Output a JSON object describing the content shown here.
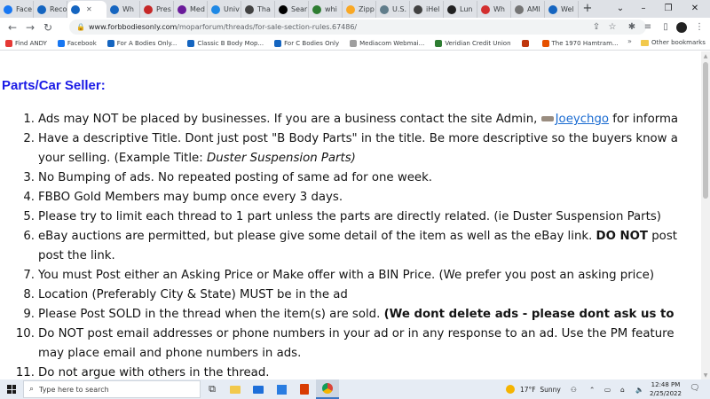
{
  "tabs": [
    {
      "label": "Face",
      "color": "#1877f2"
    },
    {
      "label": "Reco",
      "color": "#1565c0"
    },
    {
      "label": "",
      "color": "#1565c0",
      "active": true
    },
    {
      "label": "Wh",
      "color": "#1565c0"
    },
    {
      "label": "Pres",
      "color": "#c62828"
    },
    {
      "label": "Med",
      "color": "#6a1b9a"
    },
    {
      "label": "Univ",
      "color": "#1e88e5"
    },
    {
      "label": "Tha",
      "color": "#424242"
    },
    {
      "label": "Sear",
      "color": "#000000"
    },
    {
      "label": "whi",
      "color": "#2e7d32"
    },
    {
      "label": "Zipp",
      "color": "#f9a825"
    },
    {
      "label": "U.S.",
      "color": "#607d8b"
    },
    {
      "label": "iHel",
      "color": "#424242"
    },
    {
      "label": "Lun",
      "color": "#212121"
    },
    {
      "label": "Wh",
      "color": "#d32f2f"
    },
    {
      "label": "AMI",
      "color": "#757575"
    },
    {
      "label": "Wel",
      "color": "#1565c0"
    }
  ],
  "window_controls": {
    "minimize": "–",
    "maximize": "❐",
    "close": "✕",
    "overflow": "⌄"
  },
  "address": {
    "domain": "www.forbbodiesonly.com",
    "path": "/moparforum/threads/for-sale-section-rules.67486/"
  },
  "bookmarks": [
    {
      "label": "Find ANDY",
      "color": "#e53935"
    },
    {
      "label": "Facebook",
      "color": "#1877f2"
    },
    {
      "label": "For A Bodies Only...",
      "color": "#1565c0"
    },
    {
      "label": "Classic B Body Mop...",
      "color": "#1565c0"
    },
    {
      "label": "For C Bodies Only",
      "color": "#1565c0"
    },
    {
      "label": "Mediacom Webmai...",
      "color": "#9e9e9e"
    },
    {
      "label": "Veridian Credit Union",
      "color": "#2e7d32"
    },
    {
      "label": "",
      "color": "#bf360c"
    },
    {
      "label": "The 1970 Hamtram...",
      "color": "#e65100"
    }
  ],
  "bookmarks_overflow": "»",
  "other_bookmarks": "Other bookmarks",
  "page": {
    "heading": "Parts/Car Seller:",
    "rules": [
      {
        "num": "1.",
        "text": "Ads may NOT be placed by businesses. If you are a business contact the site Admin, ",
        "link": "Joeychgo",
        "after": " for informa"
      },
      {
        "num": "2.",
        "text": "Have a descriptive Title. Dont just post \"B Body Parts\" in the title. Be more descriptive so the buyers know a"
      },
      {
        "num": "",
        "text": "your selling. (Example Title: ",
        "italic": "Duster Suspension Parts)"
      },
      {
        "num": "3.",
        "text": "No Bumping of ads. No repeated posting of same ad for one week."
      },
      {
        "num": "4.",
        "text": "FBBO Gold Members may bump once every 3 days."
      },
      {
        "num": "5.",
        "text": "Please try to limit each thread to 1 part unless the parts are directly related. (ie Duster Suspension Parts)"
      },
      {
        "num": "6.",
        "text": "eBay auctions are permitted, but please give some detail of the item as well as the eBay link. ",
        "bold": "DO NOT",
        "after": " post"
      },
      {
        "num": "",
        "text": "post the link."
      },
      {
        "num": "7.",
        "text": "You must Post either an Asking Price or Make offer with a BIN Price. (We prefer you post an asking price)"
      },
      {
        "num": "8.",
        "text": "Location (Preferably City & State) MUST be in the ad"
      },
      {
        "num": "9.",
        "text": "Please Post SOLD in the thread when the item(s) are sold. ",
        "bold": "(We dont delete ads - please dont ask us to"
      },
      {
        "num": "10.",
        "text": "Do NOT post email addresses or phone numbers in your ad or in any response to an ad. Use the PM feature"
      },
      {
        "num": "",
        "text": "may place email and phone numbers in ads."
      },
      {
        "num": "11.",
        "text": "Do not argue with others in the thread."
      }
    ]
  },
  "taskbar": {
    "search_placeholder": "Type here to search",
    "weather_temp": "17°F",
    "weather_desc": "Sunny",
    "time": "12:48 PM",
    "date": "2/25/2022"
  }
}
